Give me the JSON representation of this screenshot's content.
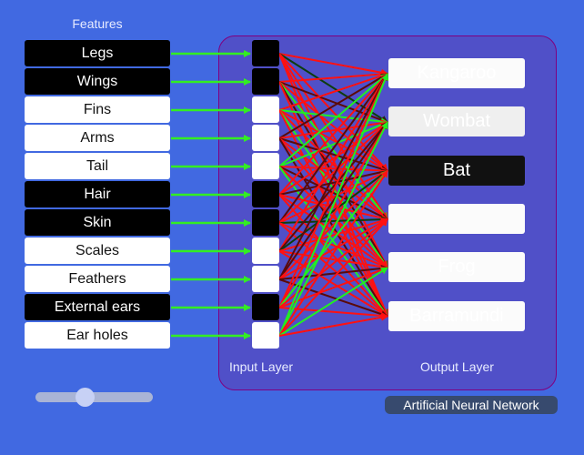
{
  "features": {
    "title": "Features",
    "items": [
      {
        "label": "Legs",
        "active": true
      },
      {
        "label": "Wings",
        "active": true
      },
      {
        "label": "Fins",
        "active": false
      },
      {
        "label": "Arms",
        "active": false
      },
      {
        "label": "Tail",
        "active": false
      },
      {
        "label": "Hair",
        "active": true
      },
      {
        "label": "Skin",
        "active": true
      },
      {
        "label": "Scales",
        "active": false
      },
      {
        "label": "Feathers",
        "active": false
      },
      {
        "label": "External ears",
        "active": true
      },
      {
        "label": "Ear holes",
        "active": false
      }
    ]
  },
  "network": {
    "input_layer_label": "Input Layer",
    "output_layer_label": "Output Layer",
    "title": "Artificial Neural Network",
    "outputs": [
      {
        "label": "Kangaroo",
        "state": "dim"
      },
      {
        "label": "Wombat",
        "state": "dim2"
      },
      {
        "label": "Bat",
        "state": "active"
      },
      {
        "label": "",
        "state": "dim"
      },
      {
        "label": "Frog",
        "state": "dim"
      },
      {
        "label": "Barramundi",
        "state": "dim"
      }
    ],
    "colors": {
      "feature_arrow": "#33ee22",
      "positive": "#22ee22",
      "negative": "#ff1111",
      "weak_negative": "#5a0a0a",
      "weak_positive": "#0d3d0d"
    },
    "weights": [
      [
        -1,
        0.1,
        -1,
        -1,
        -1,
        -1
      ],
      [
        -1,
        -0.2,
        -1,
        1,
        -0.2,
        -1
      ],
      [
        -1,
        1,
        -1,
        -1,
        1,
        -1
      ],
      [
        -0.2,
        -1,
        -0.2,
        -1,
        -1,
        -0.3
      ],
      [
        1,
        1,
        -1,
        -0.2,
        -1,
        1
      ],
      [
        -1,
        -1,
        -0.2,
        -1,
        -1,
        -1
      ],
      [
        -0.2,
        -1,
        -1,
        0.2,
        -1,
        -1
      ],
      [
        -1,
        -0.2,
        0.2,
        -1,
        -1,
        -1
      ],
      [
        -0.2,
        -0.2,
        -1,
        -1,
        -0.2,
        -0.3
      ],
      [
        -1,
        -1,
        1,
        -1,
        -1,
        -1
      ],
      [
        1,
        1,
        -1,
        -1,
        1,
        -1
      ]
    ]
  },
  "slider": {
    "value_fraction": 0.42
  }
}
